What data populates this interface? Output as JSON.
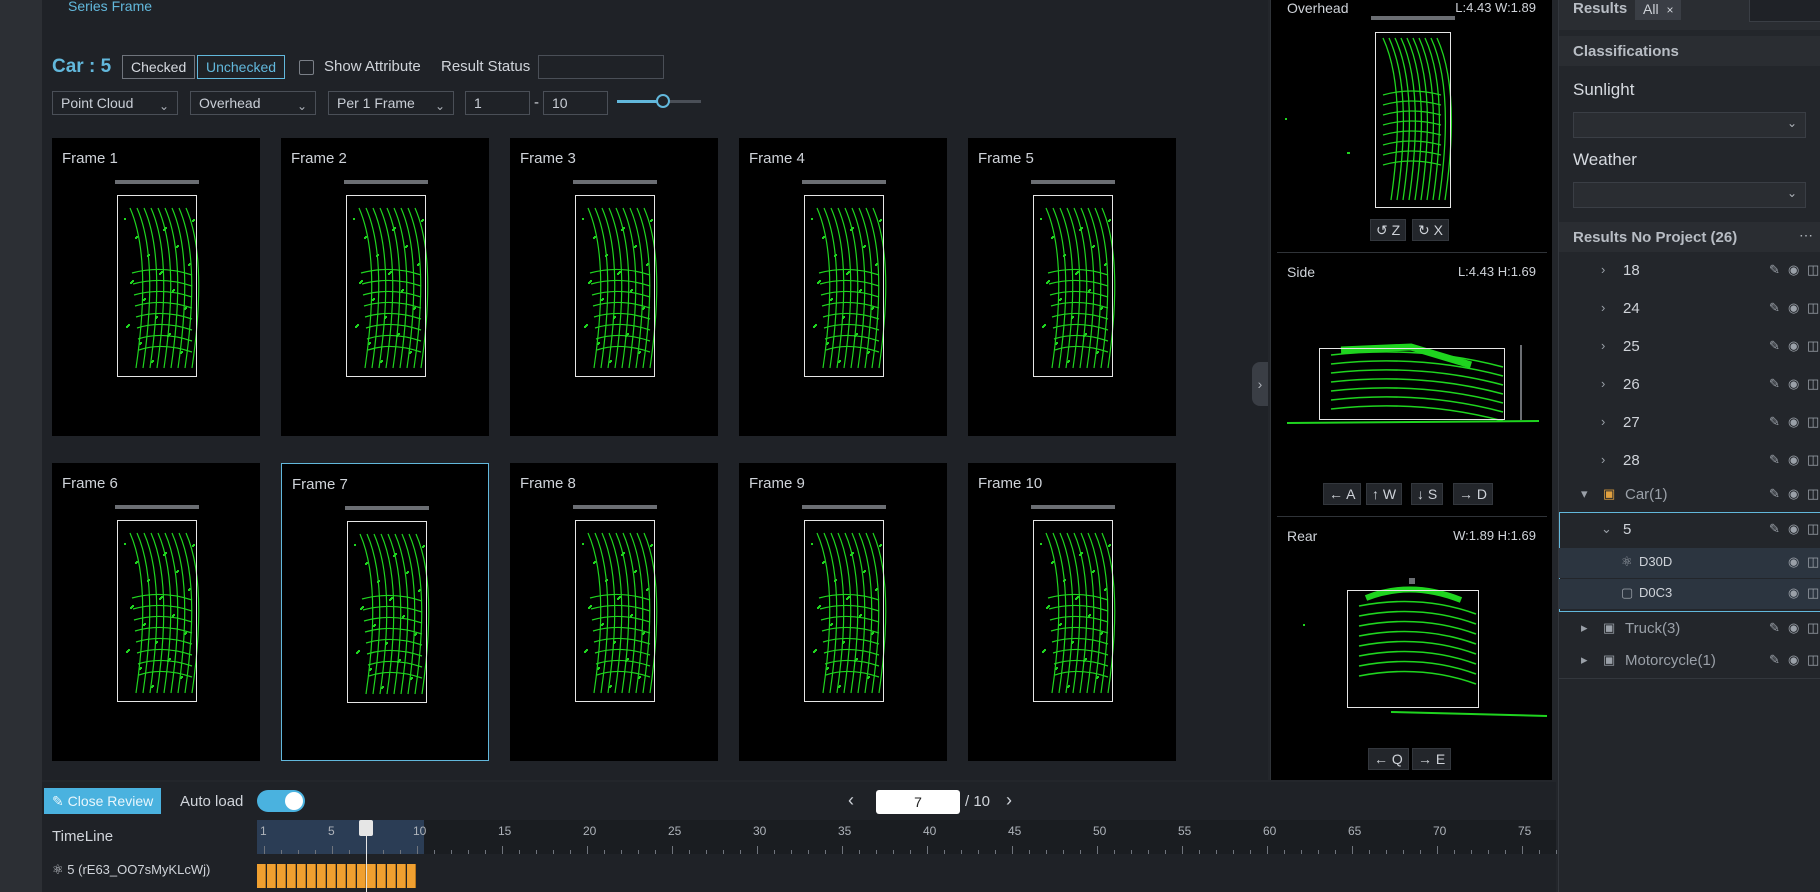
{
  "header": {
    "series_title": "Series Frame",
    "car_title": "Car : 5"
  },
  "toolbar": {
    "checked_label": "Checked",
    "unchecked_label": "Unchecked",
    "show_attribute_label": "Show Attribute",
    "result_status_label": "Result Status",
    "result_status_value": "",
    "view_type": "Point Cloud",
    "view_mode": "Overhead",
    "frame_step": "Per 1 Frame",
    "range_from": "1",
    "range_sep": "-",
    "range_to": "10",
    "slider_level_fraction": 0.55
  },
  "frames": [
    {
      "label": "Frame 1"
    },
    {
      "label": "Frame 2"
    },
    {
      "label": "Frame 3"
    },
    {
      "label": "Frame 4"
    },
    {
      "label": "Frame 5"
    },
    {
      "label": "Frame 6"
    },
    {
      "label": "Frame 7"
    },
    {
      "label": "Frame 8"
    },
    {
      "label": "Frame 9"
    },
    {
      "label": "Frame 10"
    }
  ],
  "selected_frame": "Frame 7",
  "views": {
    "overhead": {
      "title": "Overhead",
      "dims": "L:4.43 W:1.89",
      "keys": [
        "Z",
        "X"
      ]
    },
    "side": {
      "title": "Side",
      "dims": "L:4.43 H:1.69",
      "keys": [
        "A",
        "W",
        "S",
        "D"
      ]
    },
    "rear": {
      "title": "Rear",
      "dims": "W:1.89 H:1.69",
      "keys": [
        "Q",
        "E"
      ]
    }
  },
  "sidebar": {
    "results_label": "Results",
    "filter_tag": "All",
    "classifications_label": "Classifications",
    "sunlight_label": "Sunlight",
    "weather_label": "Weather",
    "results_project_label": "Results No Project (26)",
    "results": [
      "18",
      "24",
      "25",
      "26",
      "27",
      "28"
    ],
    "car_group": "Car(1)",
    "car_item": "5",
    "car_children": [
      "D30D",
      "D0C3"
    ],
    "truck_group": "Truck(3)",
    "motorcycle_group": "Motorcycle(1)"
  },
  "bottom": {
    "close_review_label": "Close Review",
    "auto_load_label": "Auto load",
    "auto_load_on": true,
    "current_page": "7",
    "total_pages": "/ 10",
    "timeline_label": "TimeLine",
    "track_label": "5 (rE63_OO7sMyKLcWj)",
    "ticks": [
      "1",
      "5",
      "10",
      "15",
      "20",
      "25",
      "30",
      "35",
      "40",
      "45",
      "50",
      "55",
      "60",
      "65",
      "70",
      "75"
    ],
    "playhead_frame": 7,
    "track_frames": 10
  },
  "colors": {
    "accent": "#62b8dc",
    "points": "#1fd41f",
    "track": "#f0a030"
  }
}
